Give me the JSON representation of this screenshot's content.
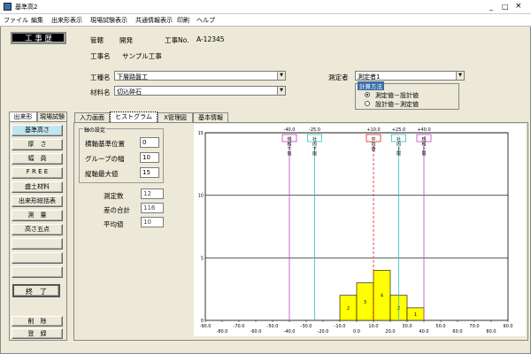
{
  "window": {
    "title": "基準高2"
  },
  "titlebar_buttons": [
    "_",
    "□",
    "×"
  ],
  "menu": [
    "ファイル",
    "編集",
    "出来形表示",
    "現場試験表示",
    "共通情報表示",
    "印刷",
    "ヘルプ"
  ],
  "header": {
    "kouji_label": "工 事 歴",
    "kankatsu_label": "管轄",
    "kankatsu_value": "開発",
    "kouji_no_label": "工事No.",
    "kouji_no_value": "A-12345",
    "kouji_mei_label": "工事名",
    "kouji_mei_value": "サンプル工事"
  },
  "form": {
    "koushu_label": "工種名",
    "koushu_value": "下層路盤工",
    "zairyo_label": "材料名",
    "zairyo_value": "切込砕石",
    "sokuteisha_label": "測定者",
    "sokuteisha_value": "測定者1",
    "keisan_label": "計算方法",
    "keisan_options": [
      "測定値－設計値",
      "設計値－測定値"
    ],
    "keisan_selected": 0
  },
  "left_tabs": [
    "出来形",
    "現場試験"
  ],
  "left_buttons": [
    "基準高さ",
    "厚　さ",
    "幅　員",
    "F R E E",
    "盛土材料",
    "出来形総括表",
    "測　量",
    "高さ五点"
  ],
  "end_button": "終　了",
  "bottom_buttons": [
    "削　除",
    "登　録"
  ],
  "main_tabs": [
    "入力画面",
    "ヒストグラム",
    "X管理図",
    "基本情報"
  ],
  "main_tab_active": 1,
  "axis_settings": {
    "group_label": "軸の設定",
    "rows": [
      {
        "label": "横軸基準位置",
        "value": "0"
      },
      {
        "label": "グループの幅",
        "value": "10"
      },
      {
        "label": "縦軸最大値",
        "value": "15"
      }
    ]
  },
  "stats": [
    {
      "label": "測定数",
      "value": "12"
    },
    {
      "label": "差の合計",
      "value": "116"
    },
    {
      "label": "平均値",
      "value": "10"
    }
  ],
  "chart_data": {
    "type": "bar",
    "categories": [
      "-10.0〜0.0",
      "0.0〜10.0",
      "10.0〜20.0",
      "20.0〜30.0",
      "30.0〜40.0"
    ],
    "values": [
      2,
      3,
      4,
      2,
      1
    ],
    "bins": [
      {
        "from": -10,
        "to": 0,
        "count": 2
      },
      {
        "from": 0,
        "to": 10,
        "count": 3
      },
      {
        "from": 10,
        "to": 20,
        "count": 4
      },
      {
        "from": 20,
        "to": 30,
        "count": 2
      },
      {
        "from": 30,
        "to": 40,
        "count": 1
      }
    ],
    "xlim": [
      -90,
      90
    ],
    "ylim": [
      0,
      15
    ],
    "yticks": [
      "0",
      "5",
      "10",
      "15"
    ],
    "xticks": [
      "-90.0",
      "-80.0",
      "-70.0",
      "-60.0",
      "-50.0",
      "-40.0",
      "-30.0",
      "-20.0",
      "-10.0",
      "0.0",
      "10.0",
      "20.0",
      "30.0",
      "40.0",
      "50.0",
      "60.0",
      "70.0",
      "80.0",
      "90.0"
    ],
    "grid": true,
    "reference_lines": [
      {
        "x": -40,
        "label": "規格下限",
        "top_label": "-40.0",
        "color": "#c040c0"
      },
      {
        "x": -25,
        "label": "社内下限",
        "top_label": "-25.0",
        "color": "#30c0c0"
      },
      {
        "x": 10,
        "label": "平均値",
        "top_label": "+10.0",
        "color": "#e02020"
      },
      {
        "x": 25,
        "label": "社内上限",
        "top_label": "+25.0",
        "color": "#30c0c0"
      },
      {
        "x": 40,
        "label": "規格上限",
        "top_label": "+40.0",
        "color": "#c040c0"
      }
    ],
    "bar_color": "#ffff00"
  }
}
